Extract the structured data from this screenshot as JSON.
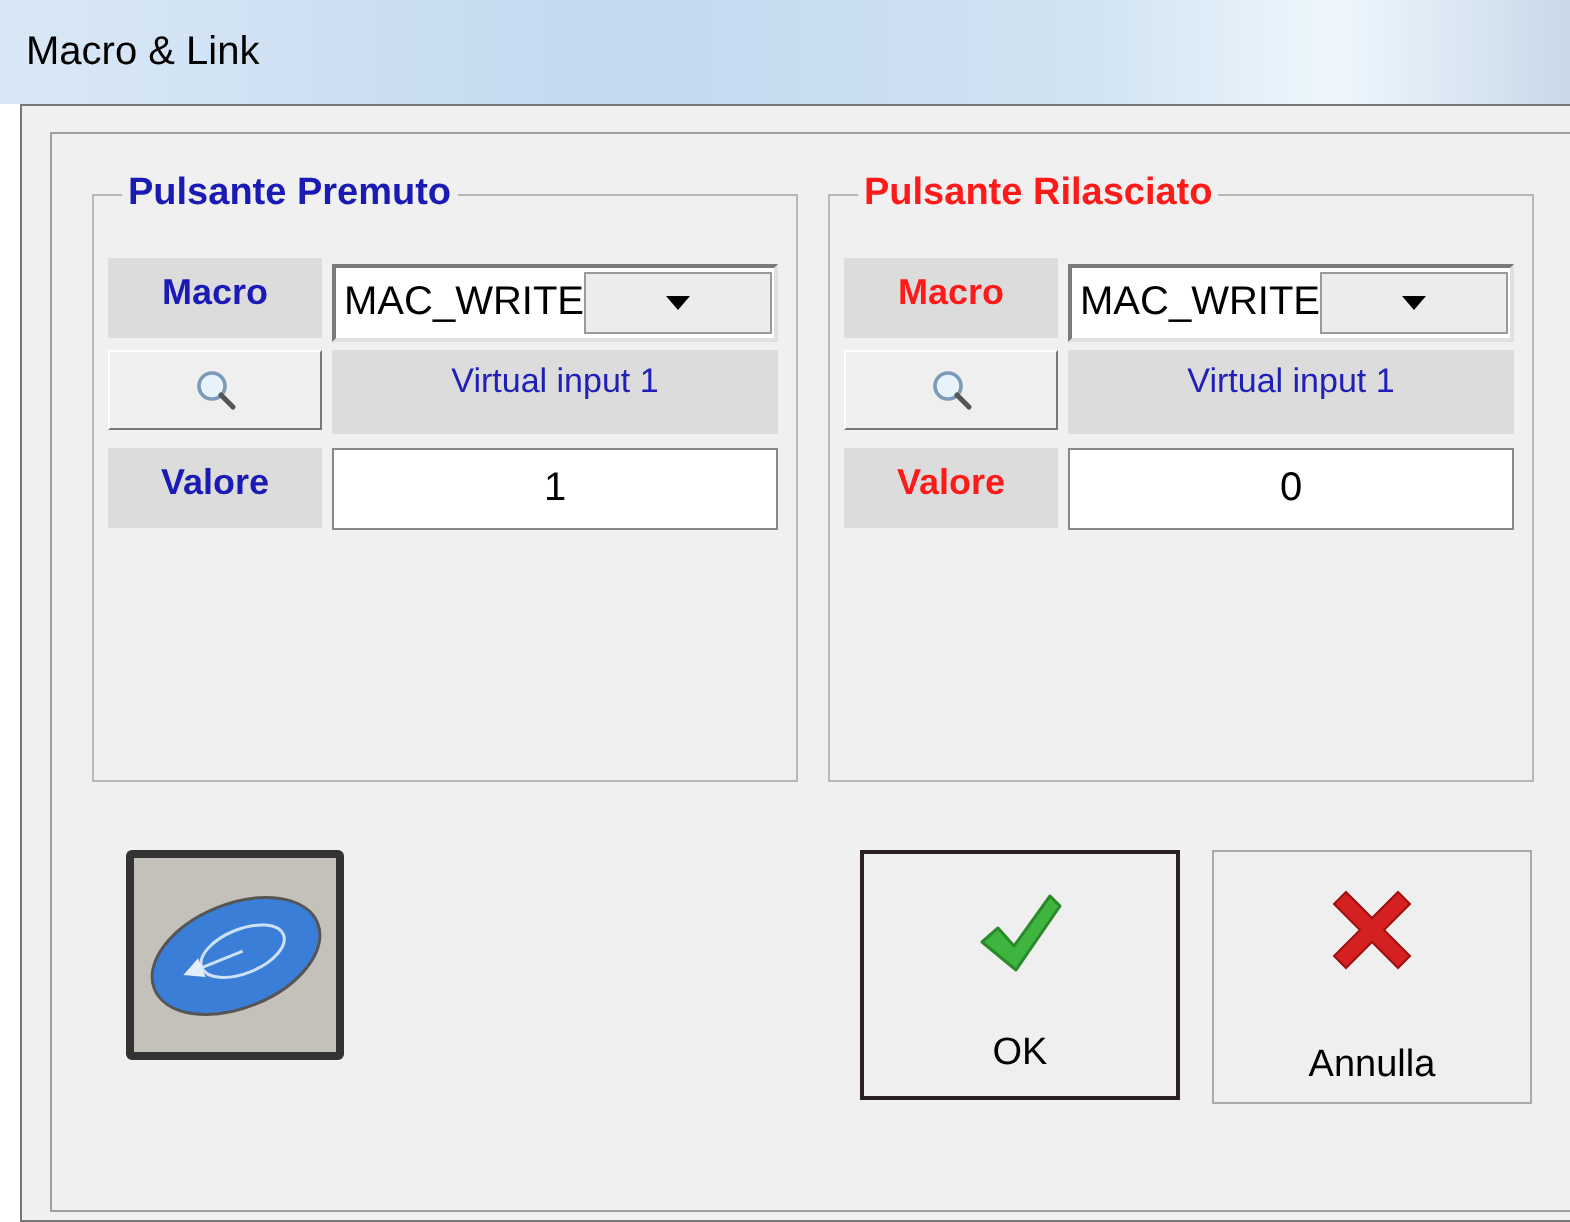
{
  "window": {
    "title": "Macro & Link"
  },
  "groups": [
    {
      "title": "Pulsante Premuto",
      "color": "#1a1ab4",
      "macro_label": "Macro",
      "macro": "MAC_WRITE",
      "target": "Virtual input 1",
      "value_label": "Valore",
      "value": "1"
    },
    {
      "title": "Pulsante Rilasciato",
      "color": "#ff1a1a",
      "macro_label": "Macro",
      "macro": "MAC_WRITE",
      "target": "Virtual input 1",
      "value_label": "Valore",
      "value": "0"
    }
  ],
  "buttons": [
    {
      "kind": "ok",
      "label": "OK",
      "default": true
    },
    {
      "kind": "cancel",
      "label": "Annulla",
      "default": false
    }
  ]
}
